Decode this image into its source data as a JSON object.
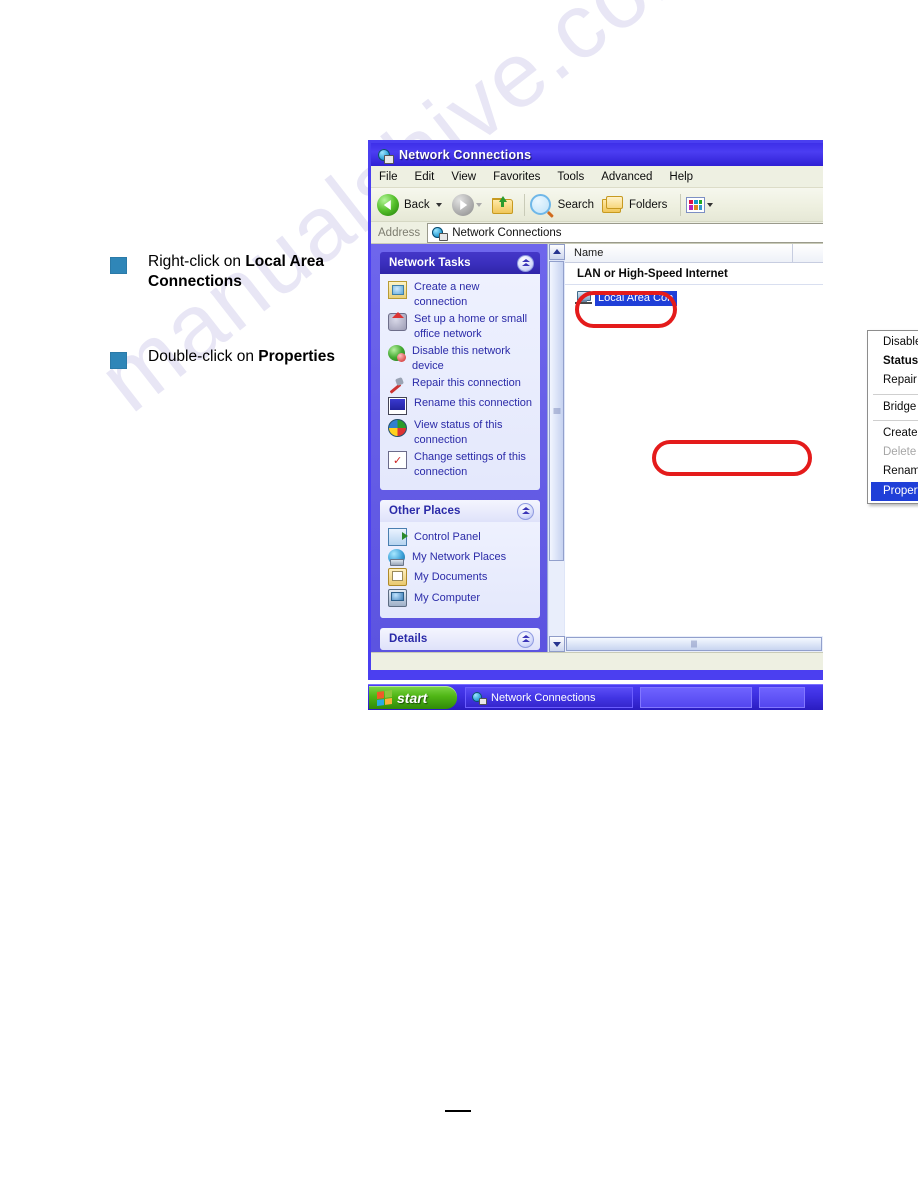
{
  "watermark": "manualshive.com",
  "instructions": [
    {
      "prefix": "Right-click on ",
      "bold": "Local Area Connections"
    },
    {
      "prefix": "Double-click on ",
      "bold": "Properties"
    }
  ],
  "window": {
    "title": "Network Connections",
    "title_icon": "network-globe-icon",
    "menus": [
      "File",
      "Edit",
      "View",
      "Favorites",
      "Tools",
      "Advanced",
      "Help"
    ],
    "toolbar": {
      "back_label": "Back",
      "back_icon": "back-arrow-icon",
      "forward_icon": "forward-arrow-icon",
      "up_icon": "up-folder-icon",
      "search_label": "Search",
      "search_icon": "magnifier-icon",
      "folders_label": "Folders",
      "folders_icon": "folders-icon",
      "views_icon": "views-icon"
    },
    "address": {
      "label": "Address",
      "icon": "network-globe-icon",
      "value": "Network Connections"
    },
    "sidebar": {
      "panels": [
        {
          "title": "Network Tasks",
          "style": "dark",
          "items": [
            {
              "label": "Create a new connection",
              "icon": "new-connection-icon"
            },
            {
              "label": "Set up a home or small office network",
              "icon": "home-network-icon"
            },
            {
              "label": "Disable this network device",
              "icon": "disable-device-icon"
            },
            {
              "label": "Repair this connection",
              "icon": "repair-icon"
            },
            {
              "label": "Rename this connection",
              "icon": "rename-icon"
            },
            {
              "label": "View status of this connection",
              "icon": "view-status-icon"
            },
            {
              "label": "Change settings of this connection",
              "icon": "change-settings-icon"
            }
          ]
        },
        {
          "title": "Other Places",
          "style": "light",
          "items": [
            {
              "label": "Control Panel",
              "icon": "control-panel-icon"
            },
            {
              "label": "My Network Places",
              "icon": "my-network-places-icon"
            },
            {
              "label": "My Documents",
              "icon": "my-documents-icon"
            },
            {
              "label": "My Computer",
              "icon": "my-computer-icon"
            }
          ]
        },
        {
          "title": "Details",
          "style": "light",
          "items": []
        }
      ]
    },
    "list": {
      "column_header": "Name",
      "group_header": "LAN or High-Speed Internet",
      "selected_item": "Local Area Con",
      "selected_item_icon": "lan-adapter-icon"
    },
    "context_menu": [
      {
        "label": "Disable",
        "state": "normal"
      },
      {
        "label": "Status",
        "state": "bold"
      },
      {
        "label": "Repair",
        "state": "normal"
      },
      {
        "label": "—sep—",
        "state": "separator"
      },
      {
        "label": "Bridge Connections",
        "state": "normal"
      },
      {
        "label": "—sep—",
        "state": "separator"
      },
      {
        "label": "Create Shortcut",
        "state": "normal"
      },
      {
        "label": "Delete",
        "state": "disabled"
      },
      {
        "label": "Rename",
        "state": "normal"
      },
      {
        "label": "Properties",
        "state": "selected"
      }
    ]
  },
  "taskbar": {
    "start_label": "start",
    "start_icon": "windows-flag-icon",
    "task_label": "Network Connections",
    "task_icon": "network-globe-icon"
  },
  "colors": {
    "accent_blue": "#4b3ff0",
    "annotation_red": "#e41b1b",
    "bullet_teal": "#2f86b8",
    "selection_blue": "#1f3fd8",
    "start_green": "#4fb515"
  }
}
